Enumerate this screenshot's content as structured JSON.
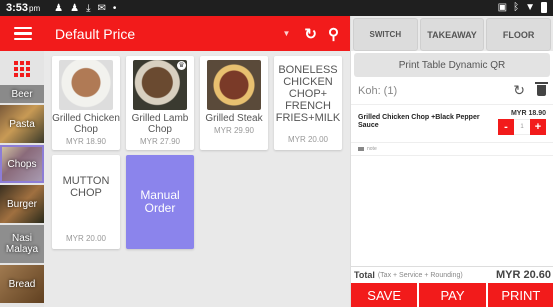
{
  "status": {
    "time": "3:53",
    "ampm": "pm"
  },
  "appbar": {
    "title": "Default Price",
    "dropdown_icon": "caret-down-icon",
    "refresh_icon": "refresh-icon",
    "search_icon": "search-icon"
  },
  "categories": [
    {
      "label": "Beer"
    },
    {
      "label": "Pasta"
    },
    {
      "label": "Chops"
    },
    {
      "label": "Burger"
    },
    {
      "label": "Nasi Malaya"
    },
    {
      "label": "Bread"
    }
  ],
  "products": [
    {
      "name": "Grilled Chicken Chop",
      "price": "MYR 18.90"
    },
    {
      "name": "Grilled Lamb Chop",
      "price": "MYR 27.90"
    },
    {
      "name": "Grilled Steak",
      "price": "MYR 29.90"
    },
    {
      "name": "BONELESS CHICKEN CHOP+ FRENCH FRIES+MILK",
      "price": "MYR 20.00"
    },
    {
      "name": "MUTTON CHOP",
      "price": "MYR 20.00"
    },
    {
      "name": "Manual Order"
    }
  ],
  "panel": {
    "modes": {
      "switch": "SWITCH",
      "takeaway": "TAKEAWAY",
      "floor": "FLOOR"
    },
    "qr_label": "Print Table Dynamic QR",
    "table_name": "Koh: (1)",
    "order_items": [
      {
        "name": "Grilled Chicken Chop  +Black Pepper Sauce",
        "price": "MYR 18.90",
        "qty": "1"
      }
    ],
    "note_placeholder": "note",
    "total_label": "Total",
    "total_sub": "(Tax + Service + Rounding)",
    "total_value": "MYR 20.60",
    "actions": {
      "save": "SAVE",
      "pay": "PAY",
      "print": "PRINT"
    }
  },
  "colors": {
    "accent": "#f21b1b",
    "manual_card": "#8b84ec"
  }
}
